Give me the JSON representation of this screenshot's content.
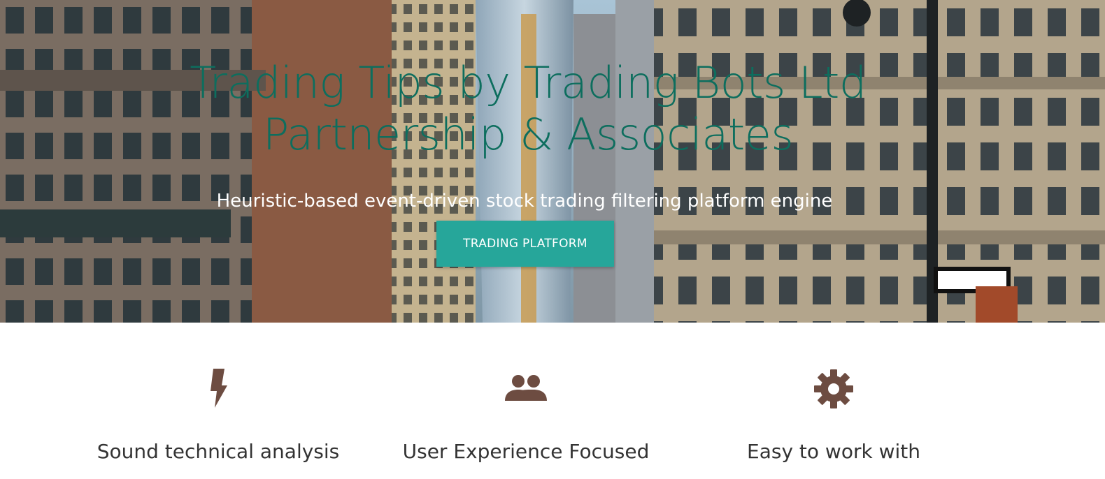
{
  "colors": {
    "title": "#0d6e5e",
    "subtitle": "#ffffff",
    "button_bg": "#26a69a",
    "button_text": "#ffffff",
    "icon": "#6d4c41",
    "feature_text": "#333333"
  },
  "hero": {
    "title": "Trading Tips by Trading Bots Ltd Partnership & Associates",
    "subtitle": "Heuristic-based event-driven stock trading filtering platform engine",
    "button_label": "TRADING PLATFORM",
    "background_image": "city-street-skyscrapers"
  },
  "features": [
    {
      "icon": "bolt-icon",
      "label": "Sound technical analysis"
    },
    {
      "icon": "people-icon",
      "label": "User Experience Focused"
    },
    {
      "icon": "gear-icon",
      "label": "Easy to work with"
    }
  ]
}
